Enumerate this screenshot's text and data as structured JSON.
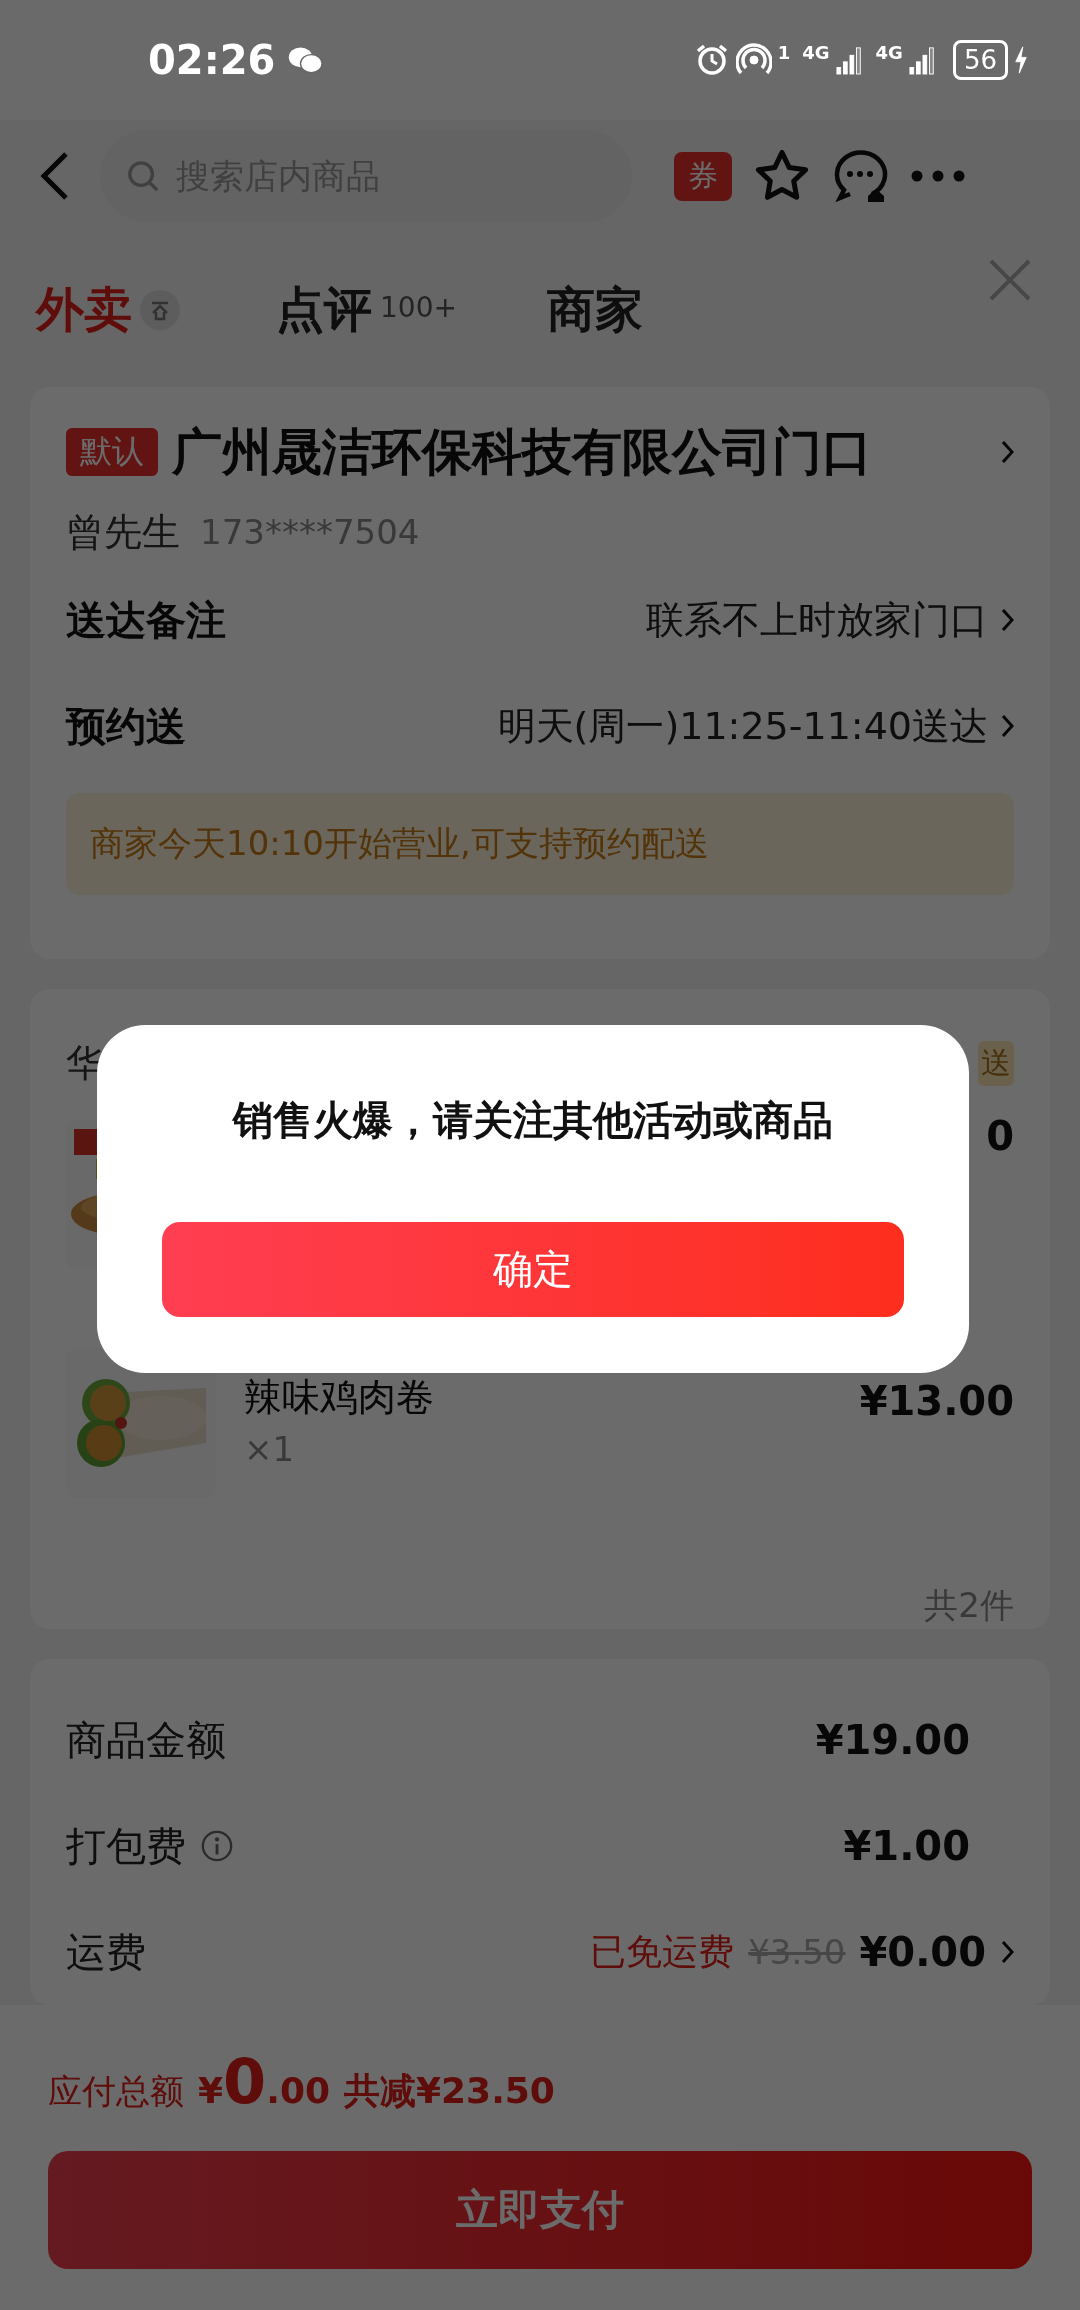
{
  "status_bar": {
    "time": "02:26",
    "hotspot_badge": "1",
    "networks": [
      {
        "label": "4G"
      },
      {
        "label": "4G"
      }
    ],
    "battery": "56"
  },
  "nav": {
    "search": {
      "placeholder": "搜索店内商品"
    },
    "coupon": "券"
  },
  "tabs": [
    {
      "label": "外卖",
      "selected": true
    },
    {
      "label": "点评",
      "badge": "100+",
      "selected": false
    },
    {
      "label": "商家",
      "selected": false
    }
  ],
  "address": {
    "tag": "默认",
    "text": "广州晟洁环保科技有限公司门口",
    "contact_name": "曾先生",
    "phone": "173****7504"
  },
  "delivery_rows": [
    {
      "label": "送达备注",
      "value": "联系不上时放家门口"
    },
    {
      "label": "预约送",
      "value": "明天(周一)11:25-11:40送达"
    }
  ],
  "notice": "商家今天10:10开始营业,可支持预约配送",
  "order": {
    "store_name": "华",
    "tag": "送",
    "items": [
      {
        "price": "0"
      },
      {
        "name": "辣味鸡肉卷",
        "qty": "×1",
        "price": "¥13.00"
      }
    ],
    "count": "共2件"
  },
  "fees": [
    {
      "label": "商品金额",
      "value": "¥19.00"
    },
    {
      "label": "打包费",
      "info": true,
      "value": "¥1.00"
    },
    {
      "label": "运费",
      "note": "已免运费",
      "original": "¥3.50",
      "value": "¥0.00",
      "chevron": true
    }
  ],
  "footer": {
    "total_label": "应付总额",
    "currency": "¥",
    "amount_int": "0",
    "amount_dec": ".00",
    "discount": "共减¥23.50",
    "pay_button": "立即支付"
  },
  "dialog": {
    "message": "销售火爆，请关注其他活动或商品",
    "confirm": "确定"
  }
}
